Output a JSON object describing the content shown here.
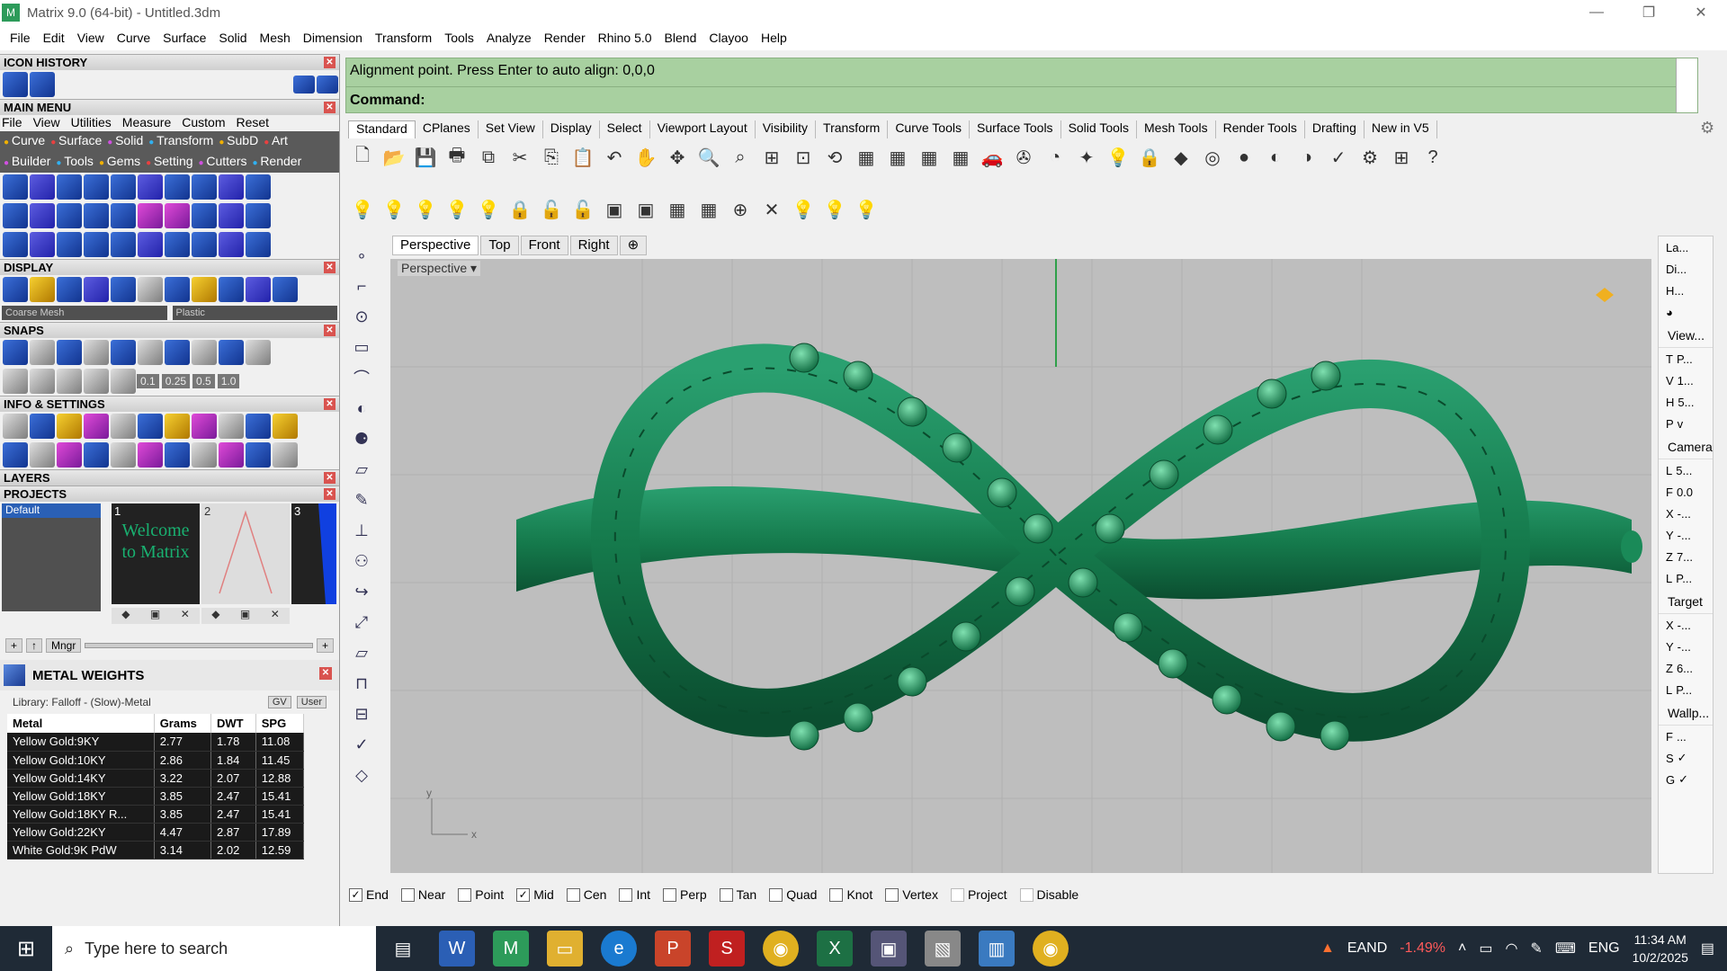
{
  "window": {
    "title": "Matrix 9.0 (64-bit) - Untitled.3dm",
    "controls": [
      "—",
      "❐",
      "✕"
    ]
  },
  "menubar": [
    "File",
    "Edit",
    "View",
    "Curve",
    "Surface",
    "Solid",
    "Mesh",
    "Dimension",
    "Transform",
    "Tools",
    "Analyze",
    "Render",
    "Rhino 5.0",
    "Blend",
    "Clayoo",
    "Help"
  ],
  "left": {
    "icon_history": "ICON HISTORY",
    "main_menu": "MAIN MENU",
    "main_menu_items": [
      "File",
      "View",
      "Utilities",
      "Measure",
      "Custom",
      "Reset"
    ],
    "main_menu_tags": [
      "Curve",
      "Surface",
      "Solid",
      "Transform",
      "SubD",
      "Art",
      "Builder",
      "Tools",
      "Gems",
      "Setting",
      "Cutters",
      "Render"
    ],
    "display": "DISPLAY",
    "display_mesh": "Coarse Mesh",
    "display_material": "Plastic",
    "snaps": "SNAPS",
    "snap_values": [
      "0.1",
      "0.25",
      "0.5",
      "1.0"
    ],
    "info_settings": "INFO & SETTINGS",
    "layers": "LAYERS",
    "projects": "PROJECTS",
    "project_default": "Default",
    "thumb_numbers": [
      "1",
      "2",
      "3"
    ],
    "welcome": "Welcome to Matrix",
    "mngr": "Mngr",
    "metal_weights": "METAL WEIGHTS",
    "library": "Library: Falloff - (Slow)-Metal",
    "gv": "GV",
    "user": "User",
    "table_headers": [
      "Metal",
      "Grams",
      "DWT",
      "SPG"
    ],
    "table_rows": [
      [
        "Yellow Gold:9KY",
        "2.77",
        "1.78",
        "11.08"
      ],
      [
        "Yellow Gold:10KY",
        "2.86",
        "1.84",
        "11.45"
      ],
      [
        "Yellow Gold:14KY",
        "3.22",
        "2.07",
        "12.88"
      ],
      [
        "Yellow Gold:18KY",
        "3.85",
        "2.47",
        "15.41"
      ],
      [
        "Yellow Gold:18KY R...",
        "3.85",
        "2.47",
        "15.41"
      ],
      [
        "Yellow Gold:22KY",
        "4.47",
        "2.87",
        "17.89"
      ],
      [
        "White Gold:9K PdW",
        "3.14",
        "2.02",
        "12.59"
      ]
    ]
  },
  "command": {
    "line1": "Alignment point. Press Enter to auto align: 0,0,0",
    "line2": "Command:"
  },
  "tabs": [
    "Standard",
    "CPlanes",
    "Set View",
    "Display",
    "Select",
    "Viewport Layout",
    "Visibility",
    "Transform",
    "Curve Tools",
    "Surface Tools",
    "Solid Tools",
    "Mesh Tools",
    "Render Tools",
    "Drafting",
    "New in V5"
  ],
  "viewport_tabs": [
    "Perspective",
    "Top",
    "Front",
    "Right"
  ],
  "viewport_label": "Perspective",
  "axis": {
    "y": "y",
    "x": "x"
  },
  "right_panel": {
    "icons": [
      "La...",
      "Di...",
      "H..."
    ],
    "view": "View...",
    "rows": [
      [
        "T",
        "P..."
      ],
      [
        "V",
        "1..."
      ],
      [
        "H",
        "5..."
      ],
      [
        "P",
        "v"
      ]
    ],
    "camera": "Camera",
    "cam_rows": [
      [
        "L",
        "5..."
      ],
      [
        "F",
        "0.0"
      ],
      [
        "X",
        "-..."
      ],
      [
        "Y",
        "-..."
      ],
      [
        "Z",
        "7..."
      ],
      [
        "L",
        "P..."
      ]
    ],
    "target": "Target",
    "tgt_rows": [
      [
        "X",
        "-..."
      ],
      [
        "Y",
        "-..."
      ],
      [
        "Z",
        "6..."
      ],
      [
        "L",
        "P..."
      ]
    ],
    "wallpaper": "Wallp...",
    "wp_rows": [
      [
        "F",
        "..."
      ],
      [
        "S",
        "✓"
      ],
      [
        "G",
        "✓"
      ]
    ]
  },
  "snapbar": [
    {
      "label": "End",
      "checked": true
    },
    {
      "label": "Near",
      "checked": false
    },
    {
      "label": "Point",
      "checked": false
    },
    {
      "label": "Mid",
      "checked": true
    },
    {
      "label": "Cen",
      "checked": false
    },
    {
      "label": "Int",
      "checked": false
    },
    {
      "label": "Perp",
      "checked": false
    },
    {
      "label": "Tan",
      "checked": false
    },
    {
      "label": "Quad",
      "checked": false
    },
    {
      "label": "Knot",
      "checked": false
    },
    {
      "label": "Vertex",
      "checked": false
    },
    {
      "label": "Project",
      "checked": false
    },
    {
      "label": "Disable",
      "checked": false
    }
  ],
  "taskbar": {
    "search_placeholder": "Type here to search",
    "stock_name": "EAND",
    "stock_change": "-1.49%",
    "lang": "ENG",
    "time": "11:34 AM",
    "date": "10/2/2025"
  },
  "colors": {
    "ring_green": "#1c8a5a",
    "command_bg": "#a8d0a0",
    "stock_red": "#ff5a5a"
  }
}
